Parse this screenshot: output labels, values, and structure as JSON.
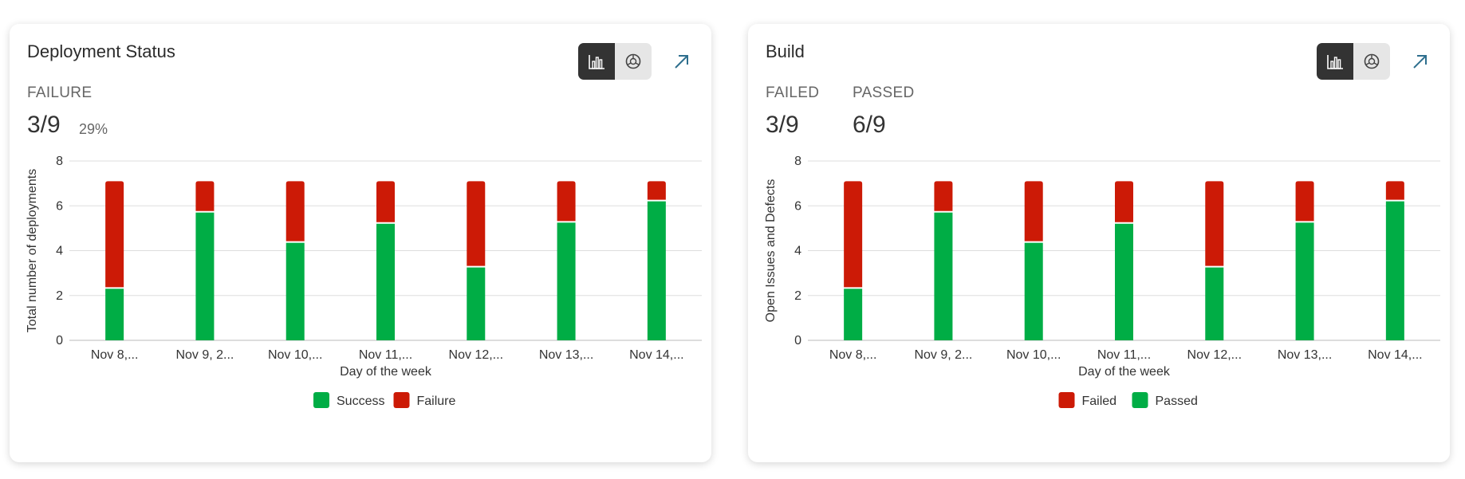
{
  "cards": [
    {
      "title": "Deployment Status",
      "metrics": [
        {
          "label": "FAILURE",
          "value": "3/9",
          "extra": "29%"
        }
      ],
      "icons": {
        "bar": "bar-chart-icon",
        "pie": "pie-chart-icon",
        "expand": "arrow-up-right-icon"
      }
    },
    {
      "title": "Build",
      "metrics": [
        {
          "label": "FAILED",
          "value": "3/9"
        },
        {
          "label": "PASSED",
          "value": "6/9"
        }
      ],
      "icons": {
        "bar": "bar-chart-icon",
        "pie": "pie-chart-icon",
        "expand": "arrow-up-right-icon"
      }
    }
  ],
  "colors": {
    "success": "#00ad45",
    "failure": "#cc1a06",
    "grid": "#dddddd",
    "active_toggle": "#333333"
  },
  "chart_data": [
    {
      "type": "bar",
      "stacked": true,
      "categories": [
        "Nov 8,...",
        "Nov 9, 2...",
        "Nov 10,...",
        "Nov 11,...",
        "Nov 12,...",
        "Nov 13,...",
        "Nov 14,..."
      ],
      "series": [
        {
          "name": "Success",
          "color": "#00ad45",
          "values": [
            2.3,
            5.7,
            4.35,
            5.2,
            3.25,
            5.25,
            6.2
          ]
        },
        {
          "name": "Failure",
          "color": "#cc1a06",
          "values": [
            4.8,
            1.4,
            2.75,
            1.9,
            3.85,
            1.85,
            0.9
          ]
        }
      ],
      "stack_order": [
        "Success",
        "Failure"
      ],
      "legend": [
        "Success",
        "Failure"
      ],
      "xlabel": "Day of the week",
      "ylabel": "Total number of deployments",
      "ylim": [
        0,
        8
      ],
      "yticks": [
        0,
        2,
        4,
        6,
        8
      ],
      "grid": true,
      "legend_position": "bottom"
    },
    {
      "type": "bar",
      "stacked": true,
      "categories": [
        "Nov 8,...",
        "Nov 9, 2...",
        "Nov 10,...",
        "Nov 11,...",
        "Nov 12,...",
        "Nov 13,...",
        "Nov 14,..."
      ],
      "series": [
        {
          "name": "Failed",
          "color": "#cc1a06",
          "values": [
            4.8,
            1.4,
            2.75,
            1.9,
            3.85,
            1.85,
            0.9
          ]
        },
        {
          "name": "Passed",
          "color": "#00ad45",
          "values": [
            2.3,
            5.7,
            4.35,
            5.2,
            3.25,
            5.25,
            6.2
          ]
        }
      ],
      "stack_order": [
        "Passed",
        "Failed"
      ],
      "legend": [
        "Failed",
        "Passed"
      ],
      "xlabel": "Day of the week",
      "ylabel": "Open Issues and Defects",
      "ylim": [
        0,
        8
      ],
      "yticks": [
        0,
        2,
        4,
        6,
        8
      ],
      "grid": true,
      "legend_position": "bottom"
    }
  ]
}
